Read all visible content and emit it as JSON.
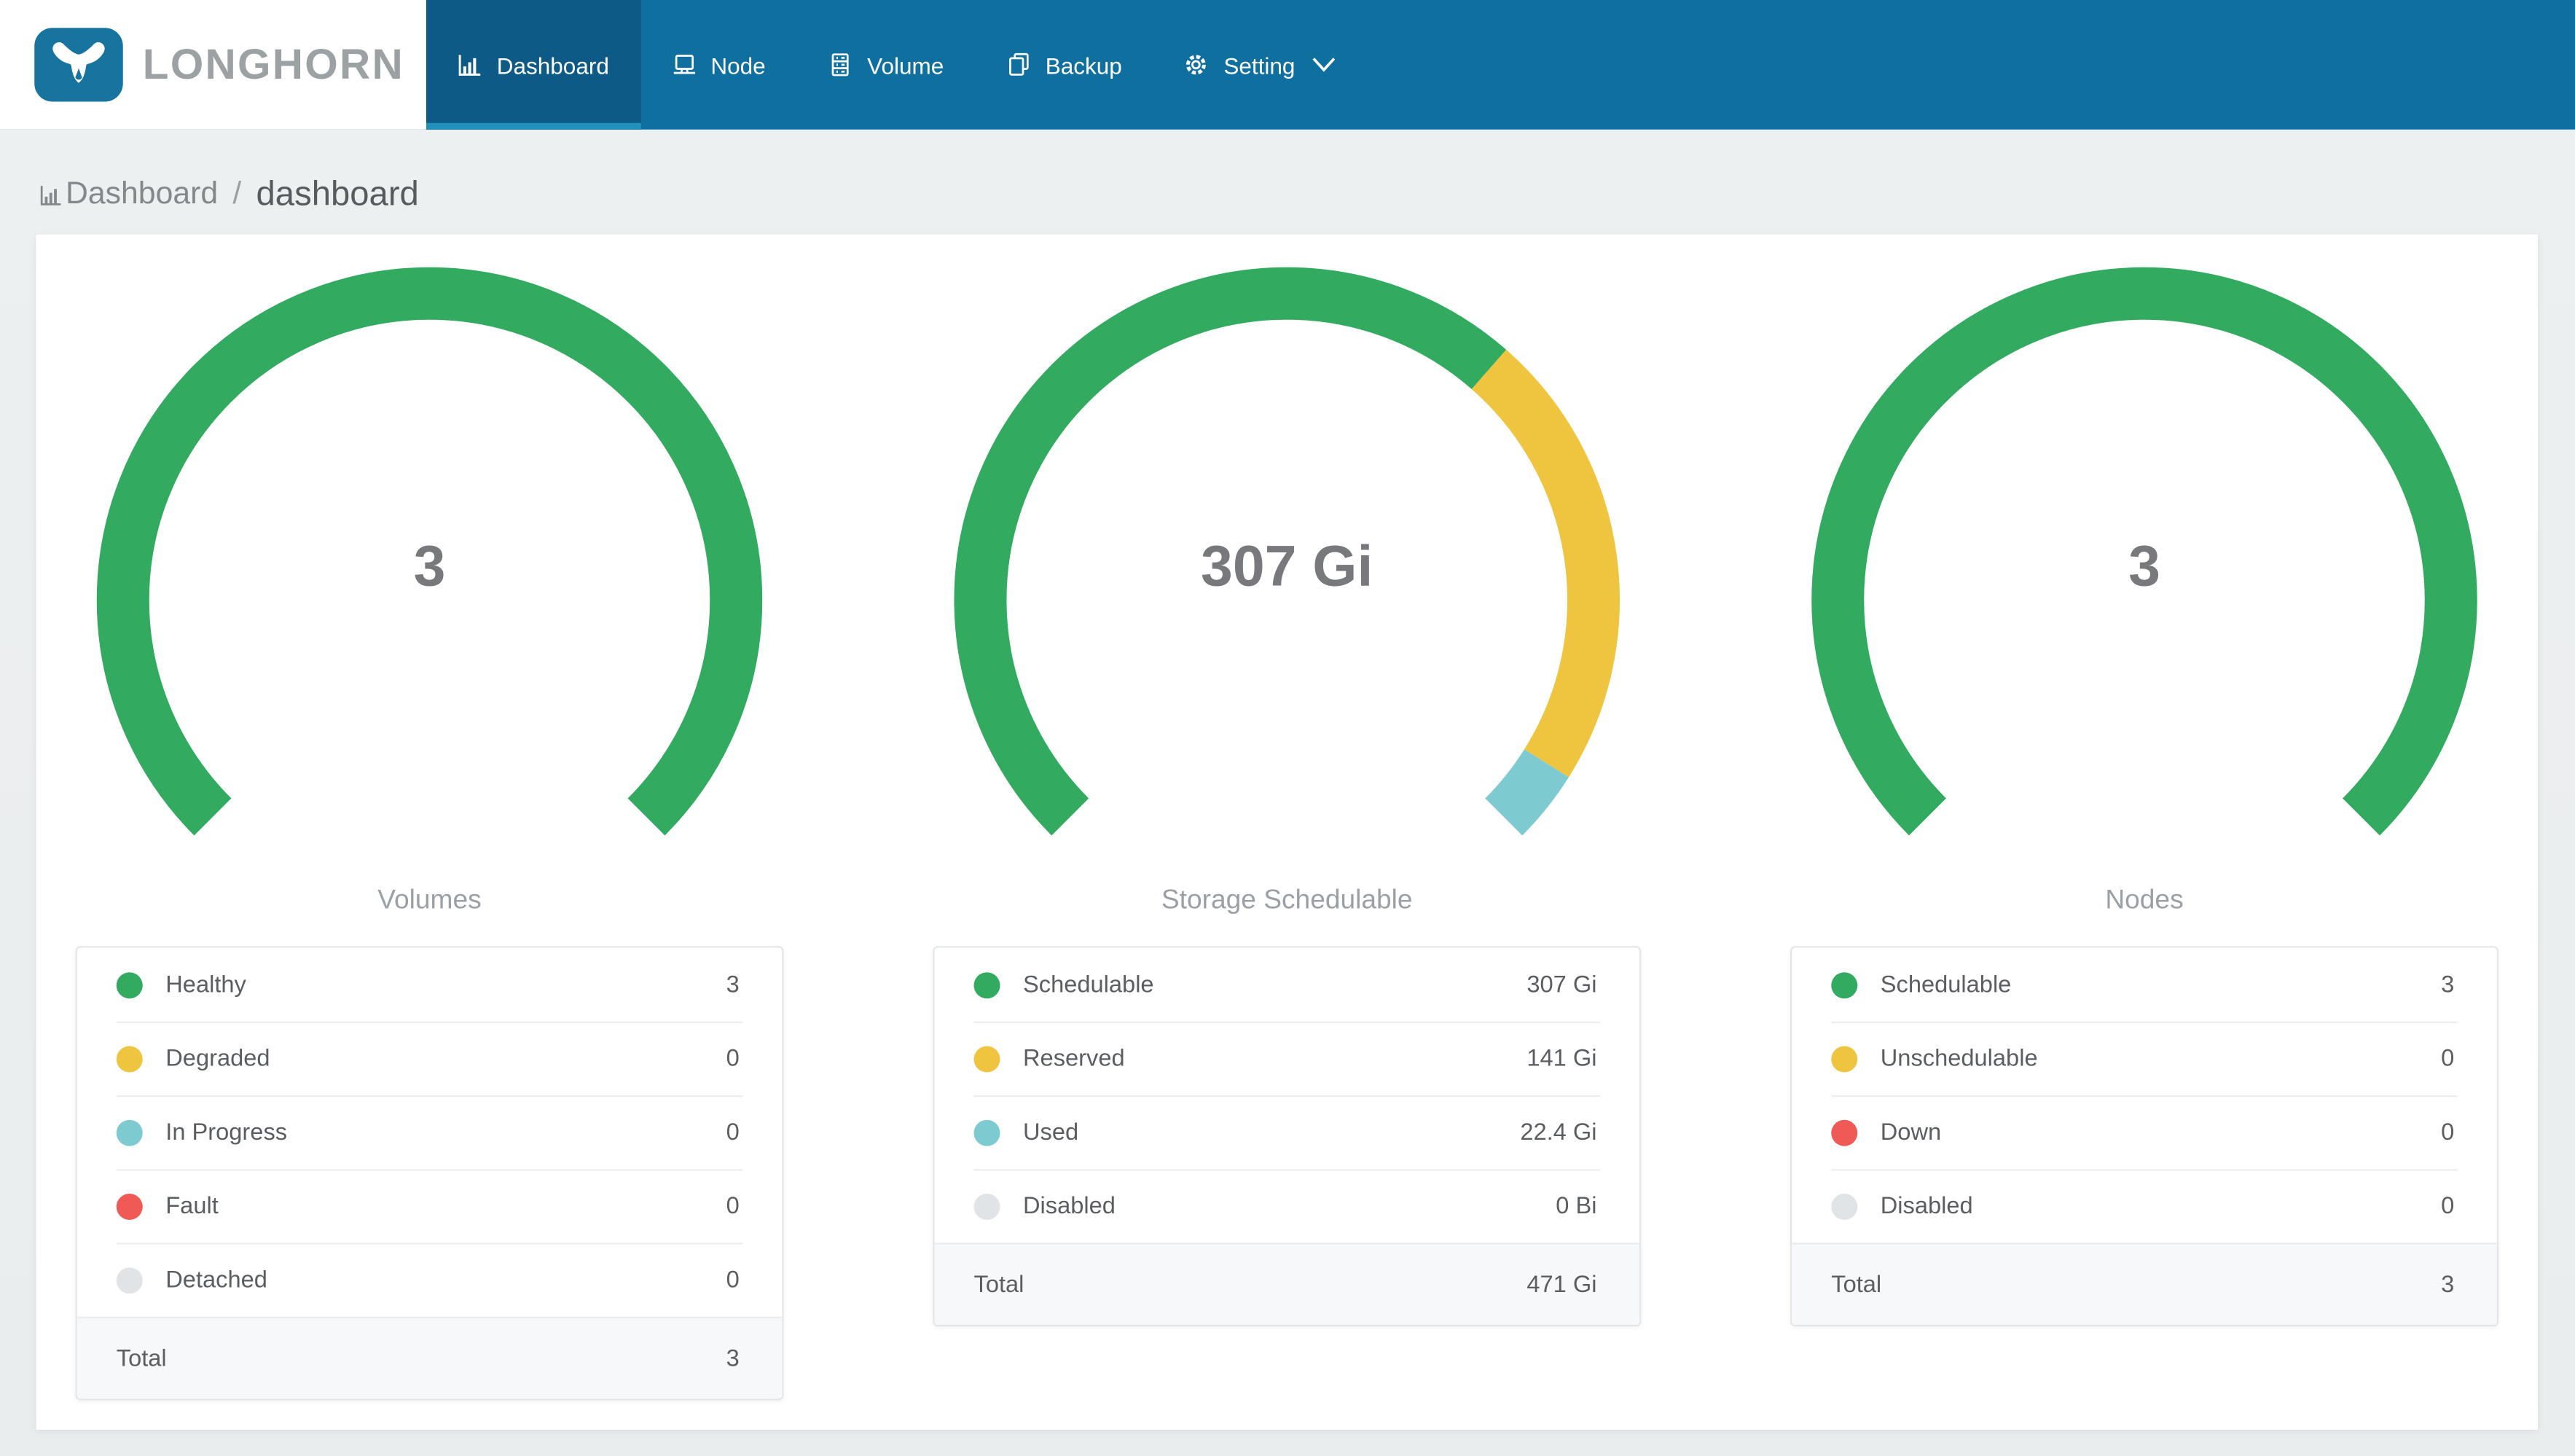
{
  "brand": {
    "name": "LONGHORN"
  },
  "nav": {
    "items": [
      {
        "id": "dashboard",
        "label": "Dashboard",
        "active": true
      },
      {
        "id": "node",
        "label": "Node",
        "active": false
      },
      {
        "id": "volume",
        "label": "Volume",
        "active": false
      },
      {
        "id": "backup",
        "label": "Backup",
        "active": false
      },
      {
        "id": "setting",
        "label": "Setting",
        "active": false,
        "has_dropdown": true
      }
    ]
  },
  "breadcrumb": {
    "section": "Dashboard",
    "separator": "/",
    "page": "dashboard"
  },
  "colors": {
    "navbar": "#0f6f9f",
    "navbar_active": "#0c5a85",
    "navbar_active_underline": "#2191bc",
    "logo_blue": "#16749f",
    "page_background": "#eceff0",
    "green": "#32ab61",
    "yellow": "#efc540",
    "teal": "#7ecad1",
    "red": "#ef5956",
    "gray": "#e1e4e6"
  },
  "chart_data": [
    {
      "type": "gauge",
      "center_value": "3",
      "center_label": "Volumes",
      "start_angle": -135,
      "end_angle": 135,
      "segments": [
        {
          "label": "Healthy",
          "value": 3,
          "display": "3",
          "color": "#32ab61"
        },
        {
          "label": "Degraded",
          "value": 0,
          "display": "0",
          "color": "#efc540"
        },
        {
          "label": "In Progress",
          "value": 0,
          "display": "0",
          "color": "#7ecad1"
        },
        {
          "label": "Fault",
          "value": 0,
          "display": "0",
          "color": "#ef5956"
        },
        {
          "label": "Detached",
          "value": 0,
          "display": "0",
          "color": "#e1e4e6"
        }
      ],
      "total": {
        "label": "Total",
        "display": "3"
      }
    },
    {
      "type": "gauge",
      "center_value": "307 Gi",
      "center_label": "Storage Schedulable",
      "start_angle": -135,
      "end_angle": 135,
      "segments": [
        {
          "label": "Schedulable",
          "value": 307,
          "display": "307 Gi",
          "color": "#32ab61"
        },
        {
          "label": "Reserved",
          "value": 141,
          "display": "141 Gi",
          "color": "#efc540"
        },
        {
          "label": "Used",
          "value": 22.4,
          "display": "22.4 Gi",
          "color": "#7ecad1"
        },
        {
          "label": "Disabled",
          "value": 0,
          "display": "0 Bi",
          "color": "#e1e4e6"
        }
      ],
      "total": {
        "label": "Total",
        "display": "471 Gi"
      }
    },
    {
      "type": "gauge",
      "center_value": "3",
      "center_label": "Nodes",
      "start_angle": -135,
      "end_angle": 135,
      "segments": [
        {
          "label": "Schedulable",
          "value": 3,
          "display": "3",
          "color": "#32ab61"
        },
        {
          "label": "Unschedulable",
          "value": 0,
          "display": "0",
          "color": "#efc540"
        },
        {
          "label": "Down",
          "value": 0,
          "display": "0",
          "color": "#ef5956"
        },
        {
          "label": "Disabled",
          "value": 0,
          "display": "0",
          "color": "#e1e4e6"
        }
      ],
      "total": {
        "label": "Total",
        "display": "3"
      }
    }
  ]
}
